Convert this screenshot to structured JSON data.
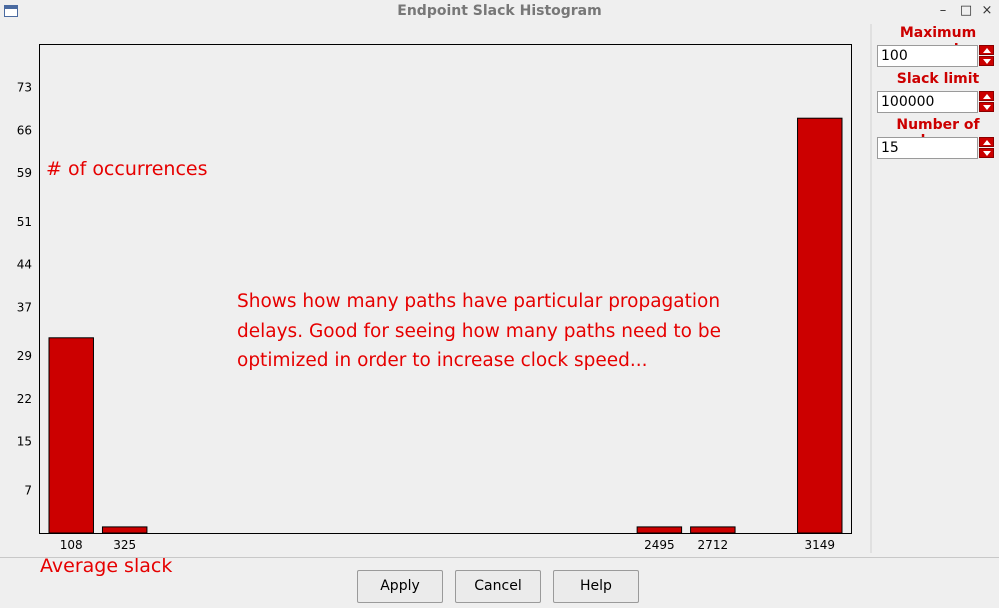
{
  "window": {
    "title": "Endpoint Slack Histogram"
  },
  "title_controls": {
    "minimize": "–",
    "maximize": "□",
    "close": "×"
  },
  "side_panel": {
    "max_count_label": "Maximum count",
    "max_count_value": "100",
    "slack_limit_label": "Slack limit",
    "slack_limit_value": "100000",
    "num_bars_label": "Number of bars",
    "num_bars_value": "15"
  },
  "buttons": {
    "apply": "Apply",
    "cancel": "Cancel",
    "help": "Help"
  },
  "annotations": {
    "y_axis": "# of occurrences",
    "x_axis": "Average slack",
    "description": [
      "Shows how many paths have particular propagation",
      "delays. Good for seeing how many paths need to be",
      "optimized in order to increase clock speed..."
    ]
  },
  "colors": {
    "bar": "#cc0000",
    "annotation": "#e60000",
    "label": "#cc0000"
  },
  "chart_data": {
    "type": "bar",
    "bar_slots": 15,
    "ylim": [
      0,
      80
    ],
    "yticks": [
      7,
      15,
      22,
      29,
      37,
      44,
      51,
      59,
      66,
      73
    ],
    "bars": [
      {
        "slot": 0,
        "label": "108",
        "value": 32
      },
      {
        "slot": 1,
        "label": "325",
        "value": 1
      },
      {
        "slot": 11,
        "label": "2495",
        "value": 1
      },
      {
        "slot": 12,
        "label": "2712",
        "value": 1
      },
      {
        "slot": 14,
        "label": "3149",
        "value": 68
      }
    ]
  }
}
